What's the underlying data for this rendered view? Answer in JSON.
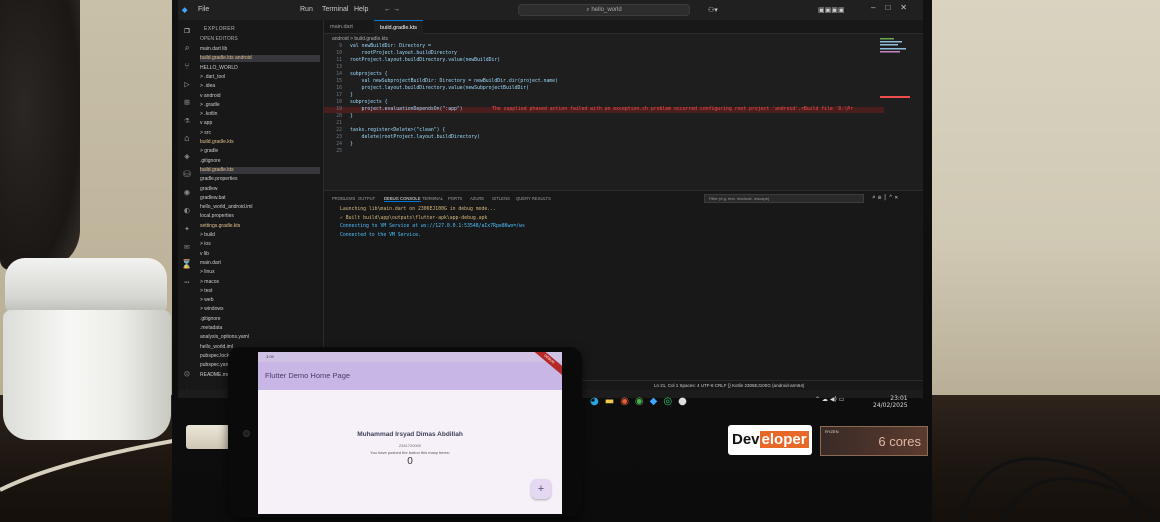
{
  "vscode": {
    "menu": [
      "File",
      "Run",
      "Terminal",
      "Help"
    ],
    "search": "hello_world",
    "explorer_header": "EXPLORER",
    "open_editors_header": "OPEN EDITORS",
    "tree_items": [
      {
        "label": "main.dart lib",
        "sel": false,
        "gradle": false
      },
      {
        "label": "build.gradle.kts android",
        "sel": true,
        "gradle": true
      },
      {
        "label": "HELLO_WORLD",
        "sel": false,
        "gradle": false
      },
      {
        "label": "> .dart_tool",
        "sel": false,
        "gradle": false
      },
      {
        "label": "> .idea",
        "sel": false,
        "gradle": false
      },
      {
        "label": "v android",
        "sel": false,
        "gradle": false
      },
      {
        "label": "> .gradle",
        "sel": false,
        "gradle": false
      },
      {
        "label": "> .kotlin",
        "sel": false,
        "gradle": false
      },
      {
        "label": "v app",
        "sel": false,
        "gradle": false
      },
      {
        "label": "> src",
        "sel": false,
        "gradle": false
      },
      {
        "label": "build.gradle.kts",
        "sel": false,
        "gradle": true
      },
      {
        "label": "> gradle",
        "sel": false,
        "gradle": false
      },
      {
        "label": ".gitignore",
        "sel": false,
        "gradle": false
      },
      {
        "label": "build.gradle.kts",
        "sel": true,
        "gradle": true
      },
      {
        "label": "gradle.properties",
        "sel": false,
        "gradle": false
      },
      {
        "label": "gradlew",
        "sel": false,
        "gradle": false
      },
      {
        "label": "gradlew.bat",
        "sel": false,
        "gradle": false
      },
      {
        "label": "hello_world_android.iml",
        "sel": false,
        "gradle": false
      },
      {
        "label": "local.properties",
        "sel": false,
        "gradle": false
      },
      {
        "label": "settings.gradle.kts",
        "sel": false,
        "gradle": true
      },
      {
        "label": "> build",
        "sel": false,
        "gradle": false
      },
      {
        "label": "> ios",
        "sel": false,
        "gradle": false
      },
      {
        "label": "v lib",
        "sel": false,
        "gradle": false
      },
      {
        "label": "main.dart",
        "sel": false,
        "gradle": false
      },
      {
        "label": "> linux",
        "sel": false,
        "gradle": false
      },
      {
        "label": "> macos",
        "sel": false,
        "gradle": false
      },
      {
        "label": "> test",
        "sel": false,
        "gradle": false
      },
      {
        "label": "> web",
        "sel": false,
        "gradle": false
      },
      {
        "label": "> windows",
        "sel": false,
        "gradle": false
      },
      {
        "label": ".gitignore",
        "sel": false,
        "gradle": false
      },
      {
        "label": ".metadata",
        "sel": false,
        "gradle": false
      },
      {
        "label": "analysis_options.yaml",
        "sel": false,
        "gradle": false
      },
      {
        "label": "hello_world.iml",
        "sel": false,
        "gradle": false
      },
      {
        "label": "pubspec.lock",
        "sel": false,
        "gradle": false
      },
      {
        "label": "pubspec.yaml",
        "sel": false,
        "gradle": false
      },
      {
        "label": "README.md",
        "sel": false,
        "gradle": false
      }
    ],
    "tabs": [
      {
        "label": "main.dart",
        "active": false
      },
      {
        "label": "build.gradle.kts",
        "active": true
      }
    ],
    "breadcrumb": "android > build.gradle.kts",
    "code_lines": [
      {
        "n": "9",
        "text": "val newBuildDir: Directory =",
        "err": false,
        "msg": ""
      },
      {
        "n": "10",
        "text": "    rootProject.layout.buildDirectory",
        "err": false,
        "msg": ""
      },
      {
        "n": "11",
        "text": "rootProject.layout.buildDirectory.value(newBuildDir)",
        "err": false,
        "msg": ""
      },
      {
        "n": "13",
        "text": "",
        "err": false,
        "msg": ""
      },
      {
        "n": "14",
        "text": "subprojects {",
        "err": false,
        "msg": ""
      },
      {
        "n": "15",
        "text": "    val newSubprojectBuildDir: Directory = newBuildDir.dir(project.name)",
        "err": false,
        "msg": ""
      },
      {
        "n": "16",
        "text": "    project.layout.buildDirectory.value(newSubprojectBuildDir)",
        "err": false,
        "msg": ""
      },
      {
        "n": "17",
        "text": "}",
        "err": false,
        "msg": ""
      },
      {
        "n": "18",
        "text": "subprojects {",
        "err": false,
        "msg": ""
      },
      {
        "n": "19",
        "text": "    project.evaluationDependsOn(\":app\")",
        "err": true,
        "msg": "The supplied phased action failed with an exception.ch problem occurred configuring root project 'android'.<Build file 'D:\\Pr"
      },
      {
        "n": "20",
        "text": "}",
        "err": false,
        "msg": ""
      },
      {
        "n": "21",
        "text": "",
        "err": false,
        "msg": ""
      },
      {
        "n": "22",
        "text": "tasks.register<Delete>(\"clean\") {",
        "err": false,
        "msg": ""
      },
      {
        "n": "23",
        "text": "    delete(rootProject.layout.buildDirectory)",
        "err": false,
        "msg": ""
      },
      {
        "n": "24",
        "text": "}",
        "err": false,
        "msg": ""
      },
      {
        "n": "25",
        "text": "",
        "err": false,
        "msg": ""
      }
    ],
    "panel_tabs": [
      {
        "label": "PROBLEMS",
        "active": false
      },
      {
        "label": "OUTPUT",
        "active": false
      },
      {
        "label": "DEBUG CONSOLE",
        "active": true
      },
      {
        "label": "TERMINAL",
        "active": false
      },
      {
        "label": "PORTS",
        "active": false
      },
      {
        "label": "AZURE",
        "active": false
      },
      {
        "label": "GITLENS",
        "active": false
      },
      {
        "label": "QUERY RESULTS",
        "active": false
      }
    ],
    "panel_filter": "Filter (e.g. text, !exclude, \\escape)",
    "console_lines": [
      {
        "text": "Launching lib\\main.dart on 2306EJ100G in debug mode...",
        "color": "#d7ba7d"
      },
      {
        "text": "✓ Built build\\app\\outputs\\flutter-apk\\app-debug.apk",
        "color": "#d7ba7d"
      },
      {
        "text": "Connecting to VM Service at ws://127.0.0.1:53548/aIx7Rpe8Kwo=/ws",
        "color": "#4fc1ff"
      },
      {
        "text": "Connected to the VM Service.",
        "color": "#4fc1ff"
      }
    ],
    "status_right": "Ln 21, Col 1   Spaces: 4   UTF-8   CRLF   {} Kotlin   2306EJ100G (android-arm64)",
    "clock_time": "23:01",
    "clock_date": "24/02/2025"
  },
  "stickers": {
    "developer_pre": "Dev",
    "developer_hl": "eloper",
    "ryzen": "RYZEN",
    "cores": "6 cores"
  },
  "phone_app": {
    "status_time": "3:05",
    "app_title": "Flutter Demo Home Page",
    "debug_banner": "DEBUG",
    "name": "Muhammad Irsyad Dimas Abdillah",
    "student_id": "2341720000",
    "push_message": "You have pushed the button this many times:",
    "counter": "0",
    "fab_label": "+"
  },
  "colors": {
    "accent": "#0078d4",
    "error": "#f14c4c",
    "app_bar": "#c8b6e6"
  }
}
